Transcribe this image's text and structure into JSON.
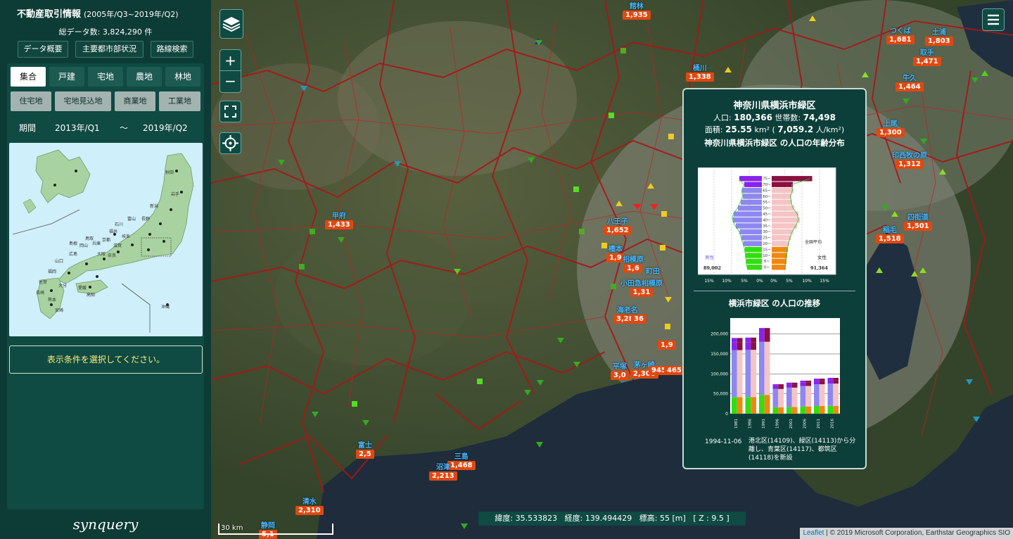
{
  "sidebar": {
    "title": "不動産取引情報",
    "title_range": "(2005年/Q3~2019年/Q2)",
    "total_count": "総データ数: 3,824,290 件",
    "top_buttons": [
      "データ概要",
      "主要都市部状況",
      "路線検索"
    ],
    "type_tabs": [
      "集合",
      "戸建",
      "宅地",
      "農地",
      "林地"
    ],
    "active_type": "集合",
    "land_tabs": [
      "住宅地",
      "宅地見込地",
      "商業地",
      "工業地"
    ],
    "period_label": "期間",
    "period_start": "2013年/Q1",
    "period_sep": "〜",
    "period_end": "2019年/Q2",
    "message": "表示条件を選択してください。",
    "brand": "synquery",
    "japan_labels": [
      "秋田",
      "岩手",
      "新潟",
      "石川",
      "富山",
      "長野",
      "岐阜",
      "福井",
      "滋賀",
      "京都",
      "兵庫",
      "岡山",
      "鳥取",
      "島根",
      "広島",
      "山口",
      "奈良",
      "大阪",
      "愛媛",
      "高知",
      "福岡",
      "佐賀",
      "長崎",
      "熊本",
      "大分",
      "宮崎",
      "沖縄"
    ]
  },
  "map": {
    "controls": {
      "zoom_in": "+",
      "zoom_out": "−"
    },
    "cities": [
      {
        "name": "館林",
        "price": "1,935"
      },
      {
        "name": "つくば",
        "price": "1,681"
      },
      {
        "name": "土浦",
        "price": "1,803"
      },
      {
        "name": "取手",
        "price": "1,471"
      },
      {
        "name": "桶川",
        "price": "1,338"
      },
      {
        "name": "上尾",
        "price": "1,300"
      },
      {
        "name": "牛久",
        "price": "1,464"
      },
      {
        "name": "印西牧の原",
        "price": "1,312"
      },
      {
        "name": "甲府",
        "price": "1,433"
      },
      {
        "name": "八王子",
        "price": "1,652"
      },
      {
        "name": "橋本",
        "price": "1,9"
      },
      {
        "name": "相模原",
        "price": "1,6"
      },
      {
        "name": "町田",
        "price": ""
      },
      {
        "name": "小田急相模原",
        "price": "1,31"
      },
      {
        "name": "四街道",
        "price": "1,501"
      },
      {
        "name": "稲毛",
        "price": "1,518"
      },
      {
        "name": "海老名",
        "price": "3,280"
      },
      {
        "name": "",
        "price": "36"
      },
      {
        "name": "",
        "price": "1,9"
      },
      {
        "name": "平塚",
        "price": "3,0"
      },
      {
        "name": "茅ヶ崎",
        "price": "2,306"
      },
      {
        "name": "",
        "price": "945"
      },
      {
        "name": "",
        "price": "465"
      },
      {
        "name": "富士",
        "price": "2,5"
      },
      {
        "name": "三島",
        "price": "1,468"
      },
      {
        "name": "沼津",
        "price": "2,213"
      },
      {
        "name": "清水",
        "price": "2,310"
      },
      {
        "name": "静岡",
        "price": "5,1"
      }
    ],
    "coords": {
      "lat_label": "緯度:",
      "lat": "35.533823",
      "lon_label": "経度:",
      "lon": "139.494429",
      "elev_label": "標高:",
      "elev": "55 [m]",
      "zoom": "[ Z : 9.5 ]"
    },
    "scale": "30 km",
    "attribution_link": "Leaflet",
    "attribution": "| © 2019 Microsoft Corporation, Earthstar Geographics SIO"
  },
  "popup": {
    "title": "神奈川県横浜市緑区",
    "pop_label": "人口:",
    "pop": "180,366",
    "households_label": "世帯数:",
    "households": "74,498",
    "area_label": "面積:",
    "area": "25.55",
    "area_unit": "km²",
    "density": "7,059.2",
    "density_unit": "人/km²",
    "chart1_title": "神奈川県横浜市緑区 の人口の年齢分布",
    "chart2_title": "横浜市緑区 の人口の推移",
    "event_date": "1994-11-06",
    "event_text": "港北区(14109)、緑区(14113)から分離し、青葉区(14117)、都筑区(14118)を新設"
  },
  "chart_data": [
    {
      "type": "bar",
      "title": "神奈川県横浜市緑区 の人口の年齢分布",
      "categories": [
        "0~",
        "5~",
        "10~",
        "15~",
        "20~",
        "25~",
        "30~",
        "35~",
        "40~",
        "45~",
        "50~",
        "55~",
        "60~",
        "65~",
        "70~",
        "75~"
      ],
      "series": [
        {
          "name": "男性",
          "values": [
            4.2,
            4.4,
            4.6,
            4.8,
            5.3,
            5.8,
            6.3,
            7.4,
            8.2,
            8.0,
            6.8,
            6.0,
            5.4,
            5.6,
            5.0,
            6.4
          ]
        },
        {
          "name": "女性",
          "values": [
            4.0,
            4.2,
            4.4,
            4.6,
            5.0,
            5.5,
            6.1,
            7.2,
            8.0,
            7.6,
            6.4,
            5.8,
            5.6,
            6.2,
            6.0,
            11.5
          ]
        }
      ],
      "totals": {
        "male": "89,002",
        "female": "91,364"
      },
      "national_avg_label": "全国平均",
      "xticks": [
        "15%",
        "10%",
        "5%",
        "0%",
        "0%",
        "5%",
        "10%",
        "15%"
      ]
    },
    {
      "type": "bar",
      "title": "横浜市緑区 の人口の推移",
      "categories": [
        "1981",
        "1986",
        "1991",
        "1996",
        "2001",
        "2006",
        "2011",
        "2016"
      ],
      "values": [
        190000,
        191000,
        215000,
        74000,
        78000,
        83000,
        88000,
        90000
      ],
      "ylim": [
        0,
        200000
      ],
      "yticks": [
        "0",
        "50,000",
        "100,000",
        "150,000",
        "200,000"
      ]
    }
  ]
}
